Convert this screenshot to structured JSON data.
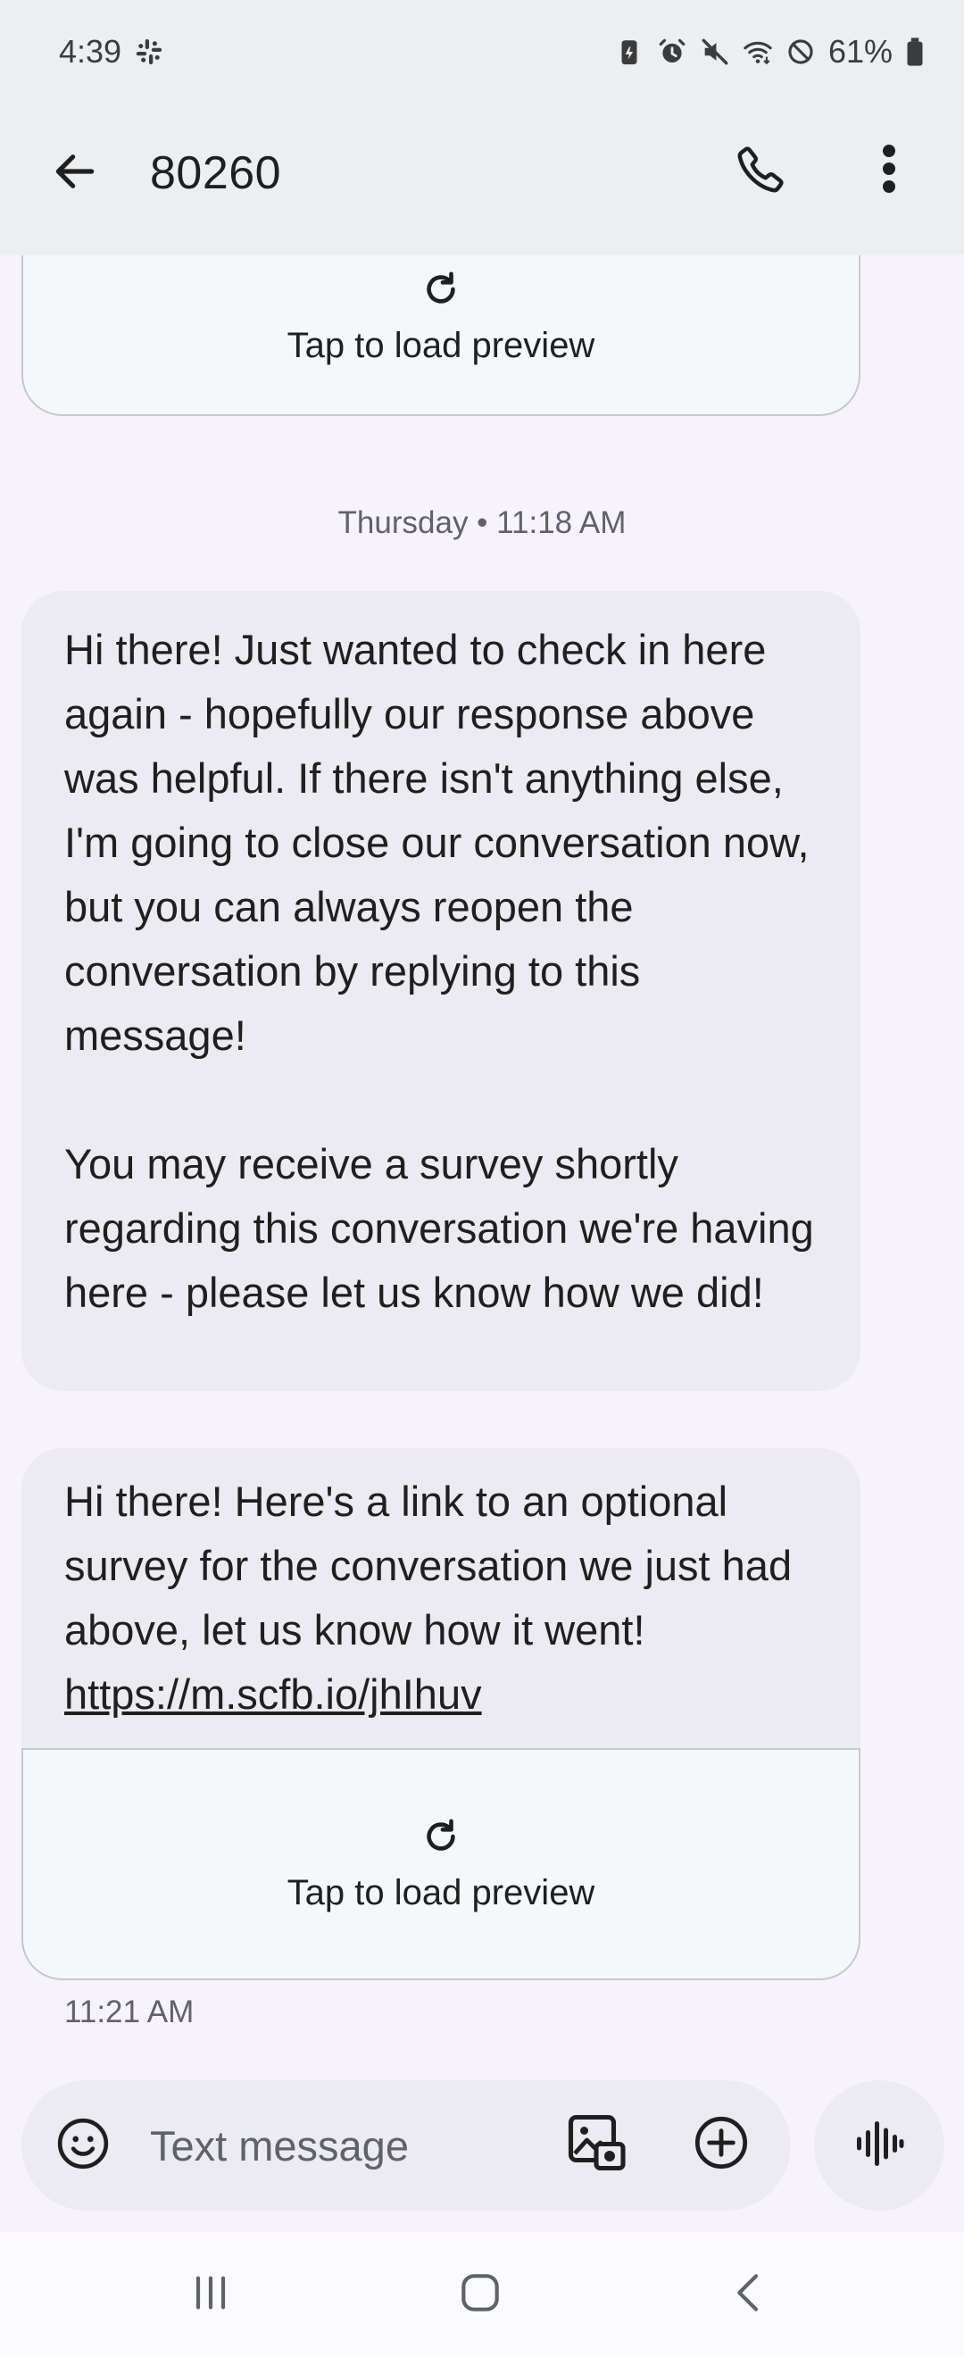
{
  "status_bar": {
    "time": "4:39",
    "battery": "61%",
    "icons": [
      "slack-icon",
      "battery-saver-icon",
      "alarm-icon",
      "mute-icon",
      "wifi-icon",
      "do-not-disturb-icon",
      "battery-icon"
    ]
  },
  "header": {
    "title": "80260",
    "icons": [
      "back-arrow-icon",
      "phone-icon",
      "more-vert-icon"
    ]
  },
  "conversation": {
    "top_preview": {
      "label": "Tap to load preview"
    },
    "date_separator": "Thursday • 11:18 AM",
    "messages": [
      {
        "paragraphs": [
          "Hi there! Just wanted to check in here again - hopefully our response above was helpful. If there isn't anything else, I'm going to close our conversation now, but you can always reopen the conversation by replying to this message!",
          "You may receive a survey shortly regarding this conversation we're having here - please let us know how we did!"
        ]
      },
      {
        "text": "Hi there! Here's a link to an optional survey for the conversation we just had above, let us know how it went!",
        "link": "https://m.scfb.io/jhIhuv",
        "preview_label": "Tap to load preview",
        "timestamp": "11:21 AM"
      }
    ]
  },
  "compose": {
    "placeholder": "Text message",
    "value": "",
    "icons": [
      "emoji-icon",
      "gallery-icon",
      "add-circle-icon",
      "voice-icon"
    ]
  },
  "nav": {
    "icons": [
      "recents-icon",
      "home-icon",
      "back-icon"
    ]
  },
  "colors": {
    "app_bar": "#eceff1",
    "background": "#f6f4fa",
    "bubble": "#ebebf1",
    "preview_card": "#f5f8fb"
  }
}
